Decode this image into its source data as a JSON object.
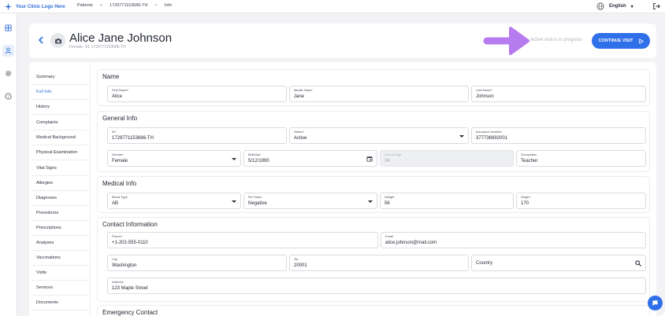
{
  "topbar": {
    "logo_text": "Your Clinic Logo Here",
    "breadcrumbs": [
      "Patients",
      "1729771153686-TH",
      "Info"
    ],
    "language": "English"
  },
  "header": {
    "patient_name": "Alice Jane Johnson",
    "patient_sub": "Female, 34, 1729771153686-TH",
    "visit_status": "Active visit is in progress",
    "continue_label": "CONTINUE VISIT"
  },
  "sidebar": {
    "active": "Full Info",
    "items": [
      "Summary",
      "Full Info",
      "History",
      "Complaints",
      "Medical Background",
      "Physical Examination",
      "Vital Signs",
      "Allergies",
      "Diagnoses",
      "Procedures",
      "Prescriptions",
      "Analyses",
      "Vaccinations",
      "Visits",
      "Services",
      "Documents"
    ]
  },
  "sections": {
    "name": {
      "title": "Name",
      "first_name": {
        "label": "First Name*",
        "value": "Alice"
      },
      "middle_name": {
        "label": "Middle Name",
        "value": "Jane"
      },
      "last_name": {
        "label": "Last Name*",
        "value": "Johnson"
      }
    },
    "general": {
      "title": "General Info",
      "id": {
        "label": "ID*",
        "value": "1729771153686-TH"
      },
      "status": {
        "label": "Status*",
        "value": "Active"
      },
      "insurance": {
        "label": "Insurance Number",
        "value": "377736992001"
      },
      "gender": {
        "label": "Gender*",
        "value": "Female"
      },
      "birthday": {
        "label": "Birthday*",
        "value": "5/12/1990"
      },
      "age": {
        "label": "Current Age",
        "value": "34"
      },
      "occupation": {
        "label": "Occupation",
        "value": "Teacher"
      }
    },
    "medical": {
      "title": "Medical Info",
      "blood_type": {
        "label": "Blood Type",
        "value": "AB"
      },
      "rh_factor": {
        "label": "Rh Factor",
        "value": "Negative"
      },
      "weight": {
        "label": "Weight",
        "value": "56"
      },
      "height": {
        "label": "Height",
        "value": "170"
      }
    },
    "contact": {
      "title": "Contact Information",
      "phone": {
        "label": "Phone*",
        "value": "+1-202-555-0110"
      },
      "email": {
        "label": "Email",
        "value": "alice.johnson@mail.com"
      },
      "city": {
        "label": "City",
        "value": "Washington"
      },
      "zip": {
        "label": "Zip",
        "value": "20001"
      },
      "country": {
        "value": "Country"
      },
      "address": {
        "label": "Address",
        "value": "123 Maple Street"
      }
    },
    "emergency": {
      "title": "Emergency Contact"
    }
  },
  "colors": {
    "accent": "#2f6fe8",
    "annotation_arrow": "#b77bf0"
  },
  "icons": [
    "logo-icon",
    "globe-icon",
    "logout-icon",
    "dashboard-icon",
    "patients-icon",
    "settings-icon",
    "help-icon",
    "back-chevron-icon",
    "camera-icon",
    "play-icon",
    "dropdown-caret-icon",
    "calendar-icon",
    "search-icon",
    "chat-icon"
  ]
}
